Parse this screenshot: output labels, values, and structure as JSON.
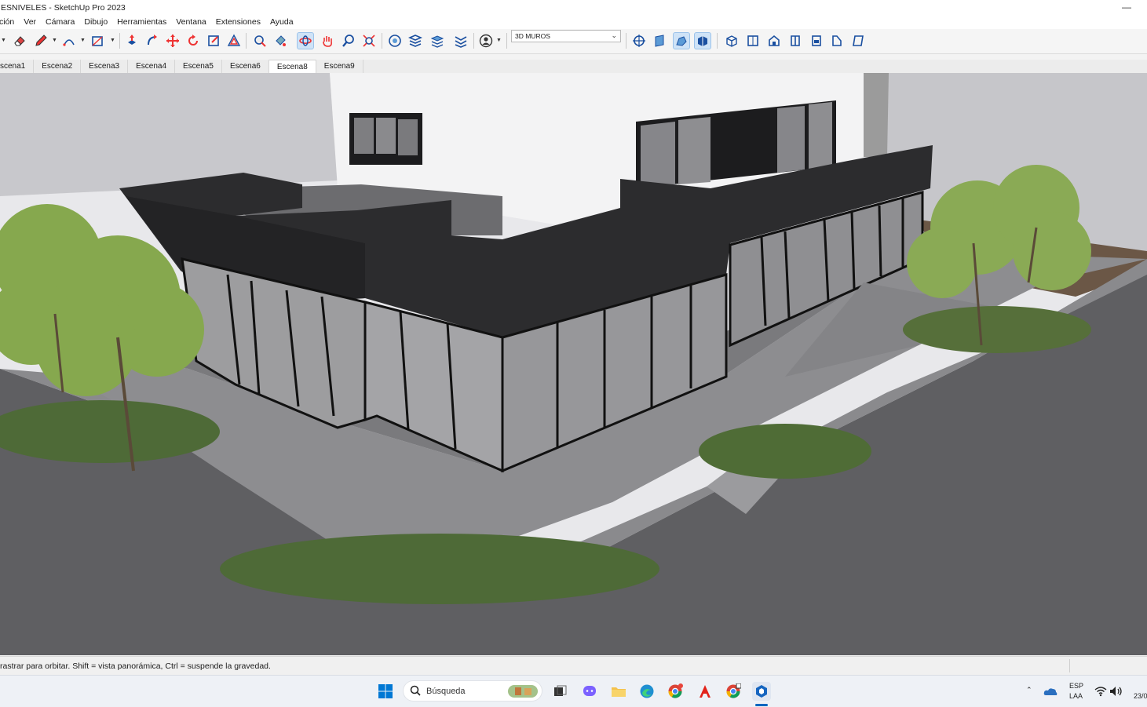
{
  "window": {
    "title": "ESNIVELES - SketchUp Pro 2023"
  },
  "menu": [
    "ción",
    "Ver",
    "Cámara",
    "Dibujo",
    "Herramientas",
    "Ventana",
    "Extensiones",
    "Ayuda"
  ],
  "toolbar": {
    "layer_value": "3D MUROS",
    "tools": [
      "eraser-icon",
      "pencil-icon",
      "arc-icon",
      "rectangle-icon",
      "push-pull-icon",
      "follow-me-icon",
      "move-icon",
      "rotate-icon",
      "scale-icon",
      "offset-icon",
      "tape-measure-icon",
      "paint-bucket-icon",
      "orbit-icon",
      "pan-icon",
      "zoom-icon",
      "zoom-extents-icon",
      "sandbox-icon",
      "layers-icon",
      "stack-icon",
      "match-photo-icon",
      "user-icon",
      "section-plane-icon",
      "section-fill-icon",
      "walk-icon",
      "look-around-icon",
      "iso-view-icon",
      "top-view-icon",
      "front-view-icon",
      "right-view-icon",
      "back-view-icon",
      "left-view-icon",
      "bottom-view-icon"
    ]
  },
  "scenes": [
    "scena1",
    "Escena2",
    "Escena3",
    "Escena4",
    "Escena5",
    "Escena6",
    "Escena8",
    "Escena9"
  ],
  "active_scene": "Escena8",
  "status": {
    "hint": "rastrar para orbitar. Shift = vista panorámica, Ctrl = suspende la gravedad."
  },
  "taskbar": {
    "search_placeholder": "Búsqueda",
    "lang_top": "ESP",
    "lang_bottom": "LAA",
    "date": "23/0"
  },
  "colors": {
    "accent": "#0067c0",
    "building_dark": "#2a2a2c",
    "ground": "#6e6e70",
    "tree_green": "#7fa24a"
  }
}
